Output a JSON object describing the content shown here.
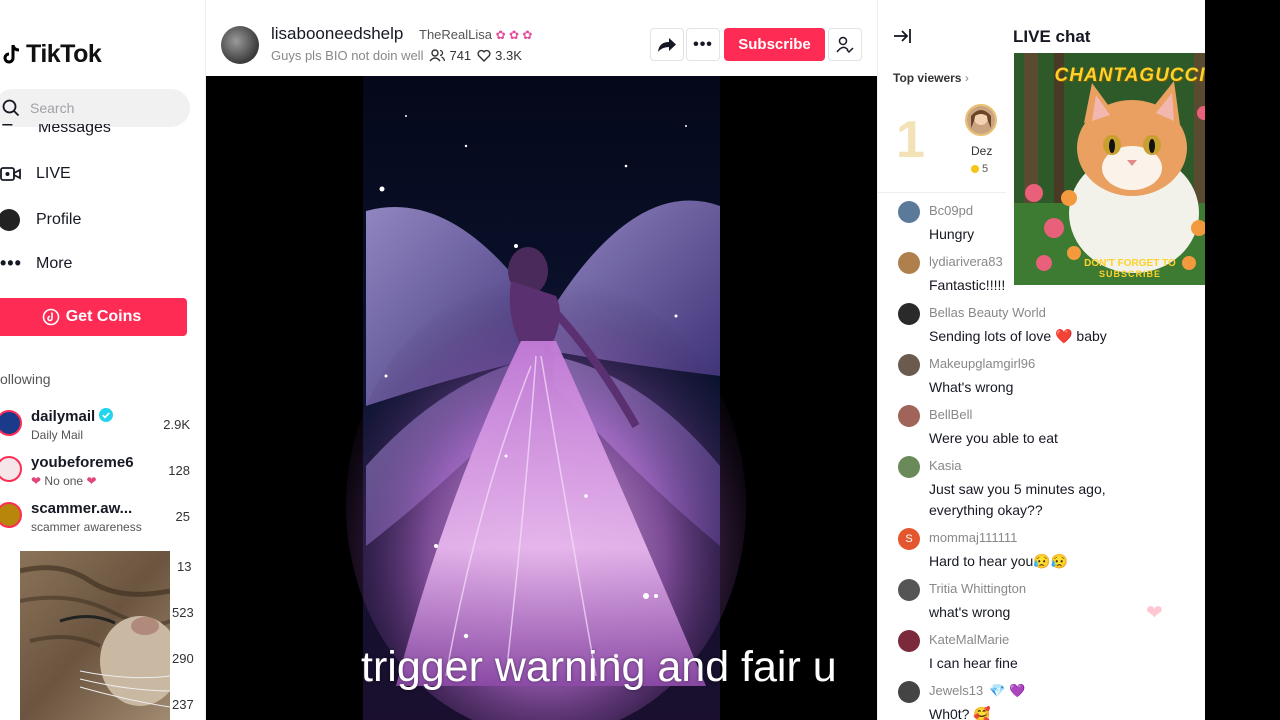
{
  "sidebar": {
    "logo_text": "TikTok",
    "search_placeholder": "Search",
    "nav_cut_label": "Messages",
    "nav": [
      {
        "label": "LIVE"
      },
      {
        "label": "Profile"
      },
      {
        "label": "More"
      }
    ],
    "get_coins_label": "Get Coins",
    "following_header": "ollowing",
    "accounts": [
      {
        "name": "dailymail",
        "subtitle": "Daily Mail",
        "count": "2.9K",
        "verified": true
      },
      {
        "name": "youbeforeme6",
        "subtitle": "No one",
        "count": "128",
        "verified": false
      },
      {
        "name": "scammer.aw...",
        "subtitle": "scammer awareness",
        "count": "25",
        "verified": false
      }
    ],
    "extra_counts": [
      "13",
      "523",
      "290",
      "237"
    ]
  },
  "header": {
    "host_name": "lisabooneedshelp",
    "host_nickname": "TheRealLisa",
    "live_title": "Guys pls BIO not doin well",
    "viewer_count": "741",
    "like_count": "3.3K",
    "subscribe_label": "Subscribe"
  },
  "video": {
    "caption": "trigger warning and fair u"
  },
  "chat": {
    "title": "LIVE chat",
    "top_viewers_label": "Top viewers",
    "top_viewer": {
      "rank": "1",
      "name": "Dez",
      "coins": "5"
    },
    "messages": [
      {
        "user": "Bc09pd",
        "text": "Hungry",
        "color": "#5b7a9a"
      },
      {
        "user": "lydiarivera83",
        "text": "Fantastic!!!!!!",
        "color": "#b0804c"
      },
      {
        "user": "Bellas Beauty World",
        "text": "Sending lots of love ❤️ baby",
        "color": "#2a2a2a"
      },
      {
        "user": "Makeupglamgirl96",
        "text": "What's wrong",
        "color": "#6b5a4e"
      },
      {
        "user": "BellBell",
        "text": "Were you able to eat",
        "color": "#a0645a"
      },
      {
        "user": "Kasia",
        "text": "Just saw you 5 minutes ago, everything okay??",
        "color": "#6a8a5a"
      },
      {
        "user": "mommaj111111",
        "text": "Hard to hear you😥😥",
        "color": "#e4572e",
        "initial": "S"
      },
      {
        "user": "Tritia Whittington",
        "text": "what's wrong",
        "color": "#555"
      },
      {
        "user": "KateMalMarie",
        "text": "I can hear fine",
        "color": "#7a2a3a"
      },
      {
        "user": "Jewels13",
        "text": "Wh0t? 🥰",
        "color": "#444",
        "badges": "💎 💜"
      }
    ]
  },
  "promo": {
    "title": "CHANTAGUCCI",
    "line1": "DON'T FORGET TO",
    "line2": "SUBSCRIBE"
  },
  "colors": {
    "accent": "#fe2c55",
    "verified": "#20d5ec",
    "gold": "#f3e2b8"
  }
}
